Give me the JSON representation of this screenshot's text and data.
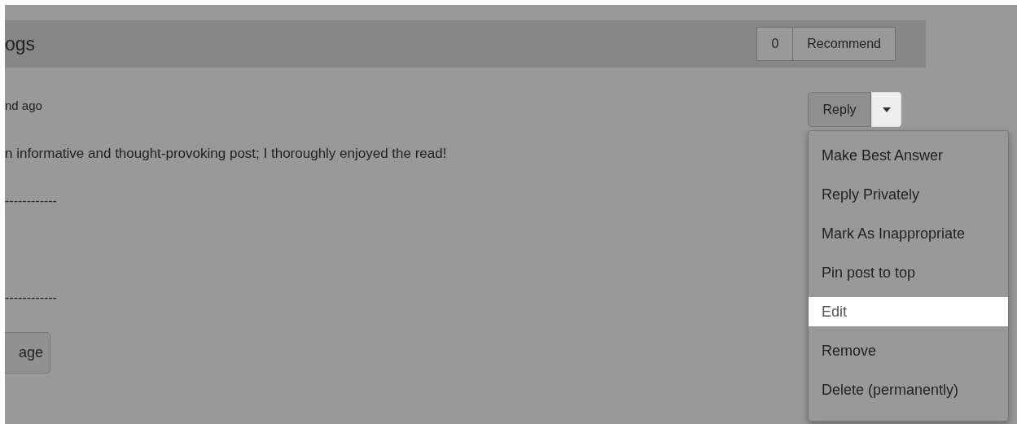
{
  "header": {
    "title": "ogs",
    "recommend_count": "0",
    "recommend_label": "Recommend"
  },
  "post": {
    "time": "nd ago",
    "body": "n informative and thought-provoking post; I thoroughly enjoyed the read!",
    "separator_top": "------------",
    "separator_bottom": "------------",
    "button": "age"
  },
  "reply": {
    "label": "Reply",
    "menu_open": true
  },
  "menu": [
    {
      "label": "Make Best Answer",
      "selected": false
    },
    {
      "label": "Reply Privately",
      "selected": false
    },
    {
      "label": "Mark As Inappropriate",
      "selected": false
    },
    {
      "label": "Pin post to top",
      "selected": false
    },
    {
      "label": "Edit",
      "selected": true
    },
    {
      "label": "Remove",
      "selected": false
    },
    {
      "label": "Delete (permanently)",
      "selected": false
    }
  ]
}
